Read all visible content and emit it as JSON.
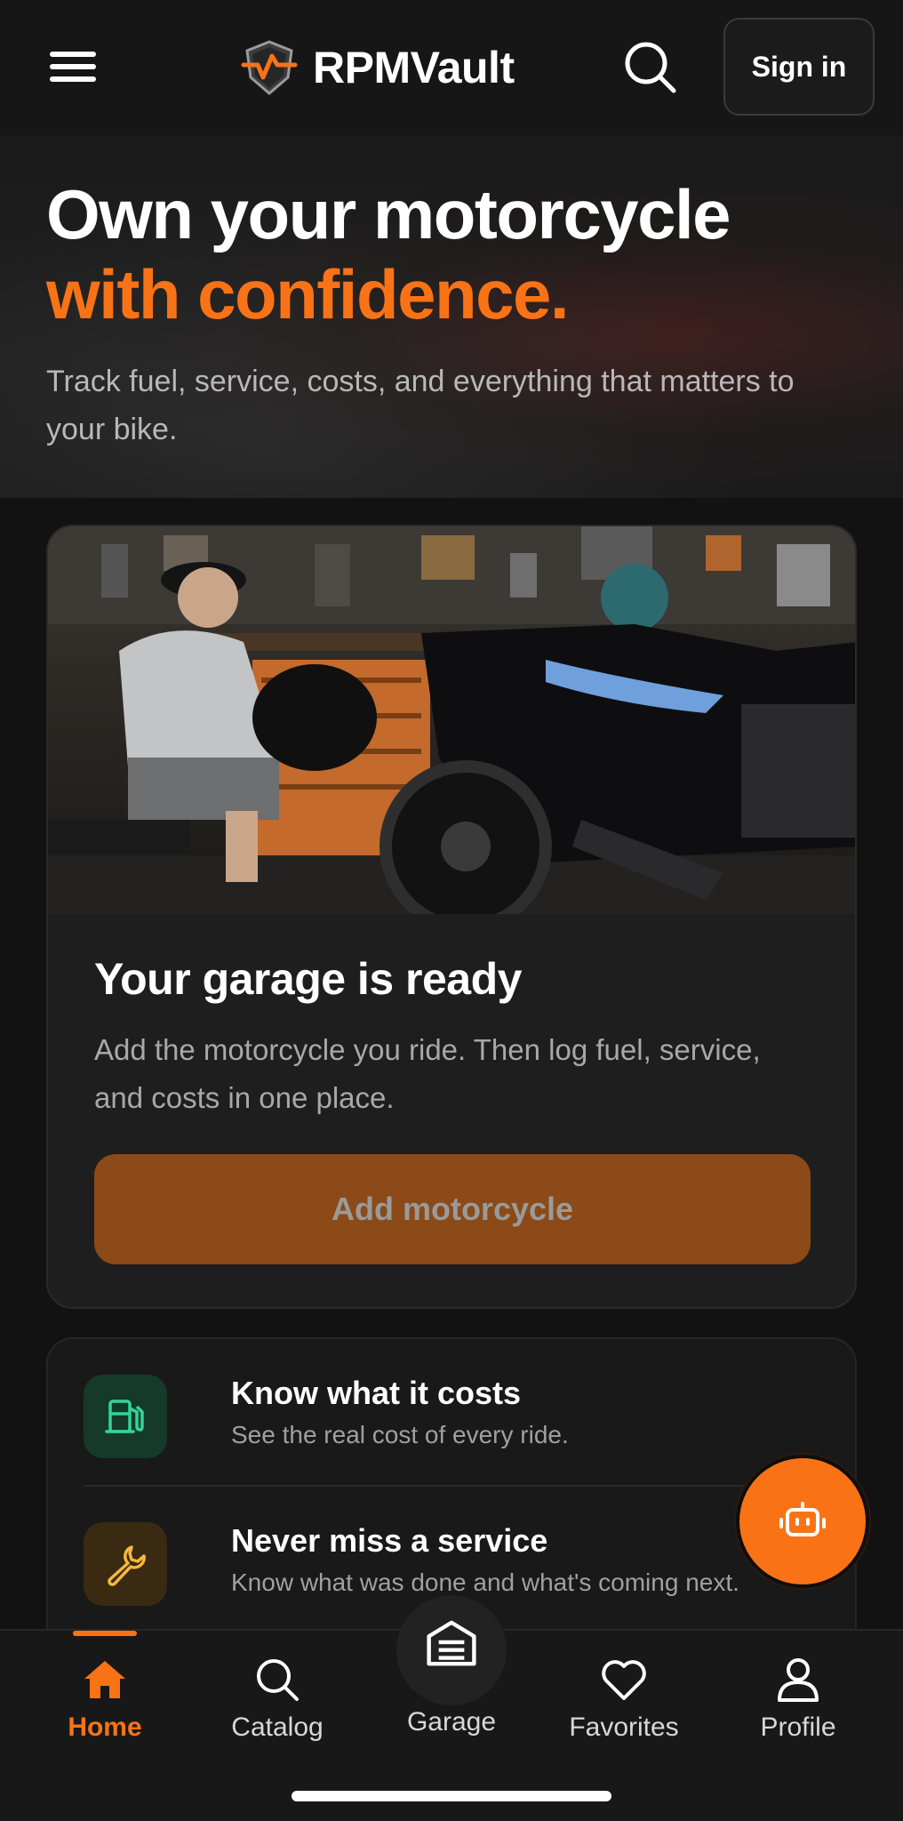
{
  "header": {
    "app_name": "RPMVault",
    "sign_in_label": "Sign in"
  },
  "hero": {
    "title_line1": "Own your motorcycle",
    "title_line2": "with confidence.",
    "subtitle": "Track fuel, service, costs, and everything that matters to your bike."
  },
  "garage_card": {
    "title": "Your garage is ready",
    "description": "Add the motorcycle you ride. Then log fuel, service, and costs in one place.",
    "button_label": "Add motorcycle"
  },
  "features": [
    {
      "title": "Know what it costs",
      "subtitle": "See the real cost of every ride.",
      "icon": "fuel-pump-icon"
    },
    {
      "title": "Never miss a service",
      "subtitle": "Know what was done and what's coming next.",
      "icon": "wrench-icon"
    }
  ],
  "fab": {
    "icon": "robot-icon"
  },
  "bottom_nav": {
    "items": [
      {
        "label": "Home",
        "icon": "home-icon",
        "active": true
      },
      {
        "label": "Catalog",
        "icon": "search-icon"
      },
      {
        "label": "Garage",
        "icon": "garage-icon"
      },
      {
        "label": "Favorites",
        "icon": "heart-icon"
      },
      {
        "label": "Profile",
        "icon": "user-icon"
      }
    ]
  },
  "colors": {
    "accent": "#f97316",
    "background": "#121212",
    "card": "#1e1e1e",
    "button_disabled": "#8b4a17"
  }
}
